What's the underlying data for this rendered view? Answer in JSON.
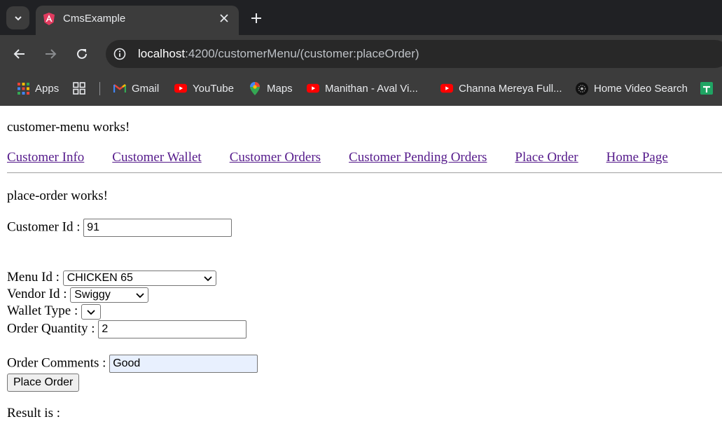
{
  "browser": {
    "tab_title": "CmsExample",
    "url_host": "localhost",
    "url_path": ":4200/customerMenu/(customer:placeOrder)",
    "bookmarks": [
      {
        "label": "Apps",
        "icon": "apps-grid-icon"
      },
      {
        "label": "Gmail",
        "icon": "gmail-icon"
      },
      {
        "label": "YouTube",
        "icon": "youtube-icon"
      },
      {
        "label": "Maps",
        "icon": "maps-icon"
      },
      {
        "label": "Manithan - Aval Vi...",
        "icon": "youtube-icon"
      },
      {
        "label": "Channa Mereya Full...",
        "icon": "youtube-icon"
      },
      {
        "label": "Home Video Search",
        "icon": "video-search-icon"
      }
    ],
    "colors": {
      "tabstrip": "#202124",
      "toolbar": "#3c3c3c",
      "youtube": "#ff0000"
    }
  },
  "page": {
    "menu_heading": "customer-menu works!",
    "nav": {
      "customer_info": "Customer Info",
      "customer_wallet": "Customer Wallet",
      "customer_orders": "Customer Orders",
      "customer_pending_orders": "Customer Pending Orders",
      "place_order": "Place Order",
      "home_page": "Home Page"
    },
    "place_order_heading": "place-order works!",
    "form": {
      "customer_id_label": "Customer Id :",
      "customer_id_value": "91",
      "menu_id_label": "Menu Id :",
      "menu_id_selected": "CHICKEN 65",
      "vendor_id_label": "Vendor Id :",
      "vendor_id_selected": "Swiggy",
      "wallet_type_label": "Wallet Type :",
      "wallet_type_selected": "",
      "order_quantity_label": "Order Quantity :",
      "order_quantity_value": "2",
      "order_comments_label": "Order Comments :",
      "order_comments_value": "Good",
      "submit_label": "Place Order"
    },
    "result_label": "Result is :",
    "link_color": "#551a8b"
  }
}
